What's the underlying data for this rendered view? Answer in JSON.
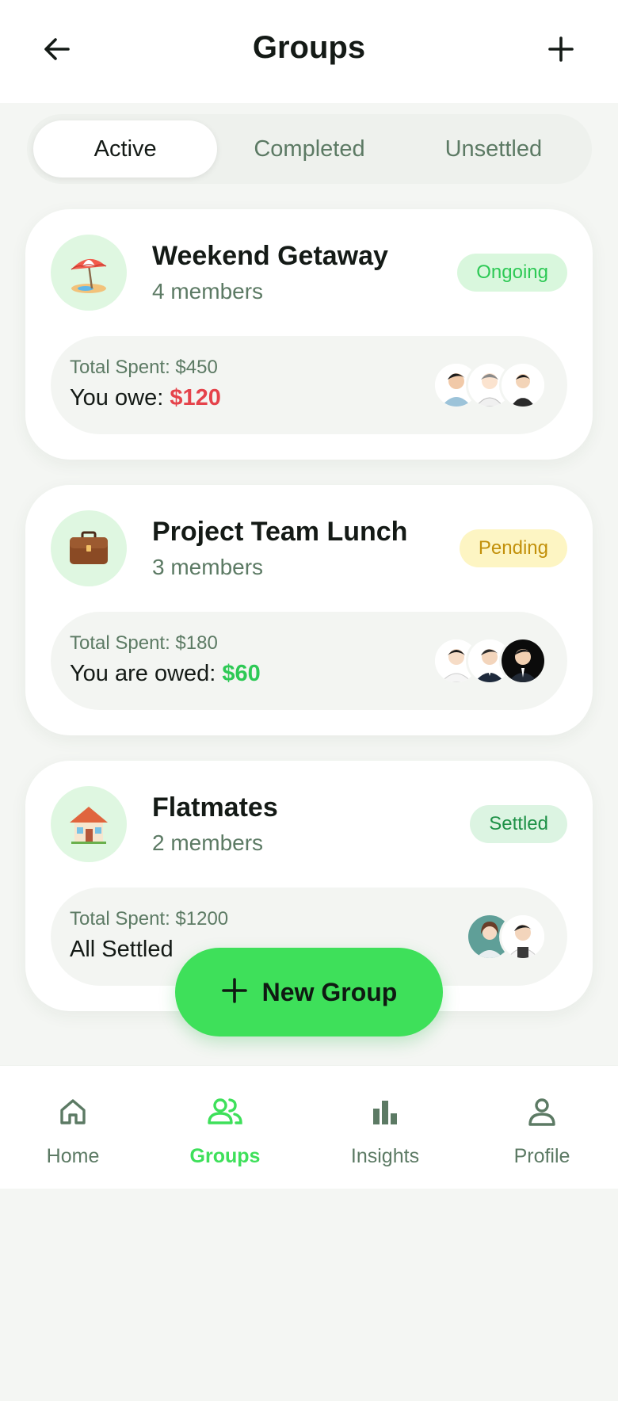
{
  "header": {
    "title": "Groups",
    "back_icon": "arrow-left-icon",
    "add_icon": "plus-icon"
  },
  "tabs": [
    {
      "label": "Active",
      "active": true
    },
    {
      "label": "Completed",
      "active": false
    },
    {
      "label": "Unsettled",
      "active": false
    }
  ],
  "groups": [
    {
      "name": "Weekend Getaway",
      "members": "4 members",
      "status": "Ongoing",
      "icon": "beach-umbrella-icon",
      "total": "Total Spent: $450",
      "balance_prefix": "You owe: ",
      "balance_amount": "$120"
    },
    {
      "name": "Project Team Lunch",
      "members": "3 members",
      "status": "Pending",
      "icon": "briefcase-icon",
      "total": "Total Spent: $180",
      "balance_prefix": "You are owed: ",
      "balance_amount": "$60"
    },
    {
      "name": "Flatmates",
      "members": "2 members",
      "status": "Settled",
      "icon": "house-icon",
      "total": "Total Spent: $1200",
      "balance_prefix": "All Settled",
      "balance_amount": ""
    }
  ],
  "fab": {
    "label": "New Group",
    "icon": "plus-icon"
  },
  "nav": [
    {
      "label": "Home",
      "icon": "home-icon",
      "active": false
    },
    {
      "label": "Groups",
      "icon": "users-icon",
      "active": true
    },
    {
      "label": "Insights",
      "icon": "bar-chart-icon",
      "active": false
    },
    {
      "label": "Profile",
      "icon": "person-icon",
      "active": false
    }
  ],
  "colors": {
    "accent": "#3ee05a",
    "owe": "#e5434b",
    "owed": "#2dc955",
    "muted": "#5c7a64",
    "background": "#f4f6f3"
  }
}
